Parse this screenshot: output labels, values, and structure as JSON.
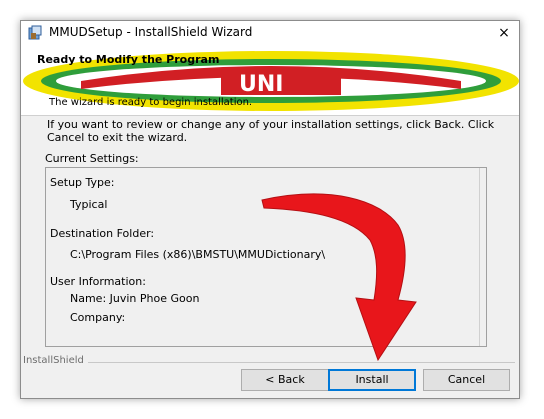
{
  "window": {
    "title": "MMUDSetup - InstallShield Wizard",
    "close_icon": "×"
  },
  "banner": {
    "title": "Ready to Modify the Program",
    "subtitle": "The wizard is ready to begin installation.",
    "logo_text": "UNI"
  },
  "intro_text": "If you want to review or change any of your installation settings, click Back. Click Cancel to exit the wizard.",
  "current_settings": {
    "label": "Current Settings:",
    "setup_type_label": "Setup Type:",
    "setup_type_value": "Typical",
    "destination_label": "Destination Folder:",
    "destination_value": "C:\\Program Files (x86)\\BMSTU\\MMUDictionary\\",
    "user_info_label": "User Information:",
    "name_line": "Name: Juvin Phoe Goon",
    "company_line": "Company:"
  },
  "brand": "InstallShield",
  "buttons": {
    "back": "< Back",
    "install": "Install",
    "cancel": "Cancel"
  },
  "colors": {
    "arrow_red": "#e8161b",
    "banner_yellow": "#f2e300",
    "banner_green": "#2f9e3b",
    "focus_blue": "#0078d7"
  }
}
